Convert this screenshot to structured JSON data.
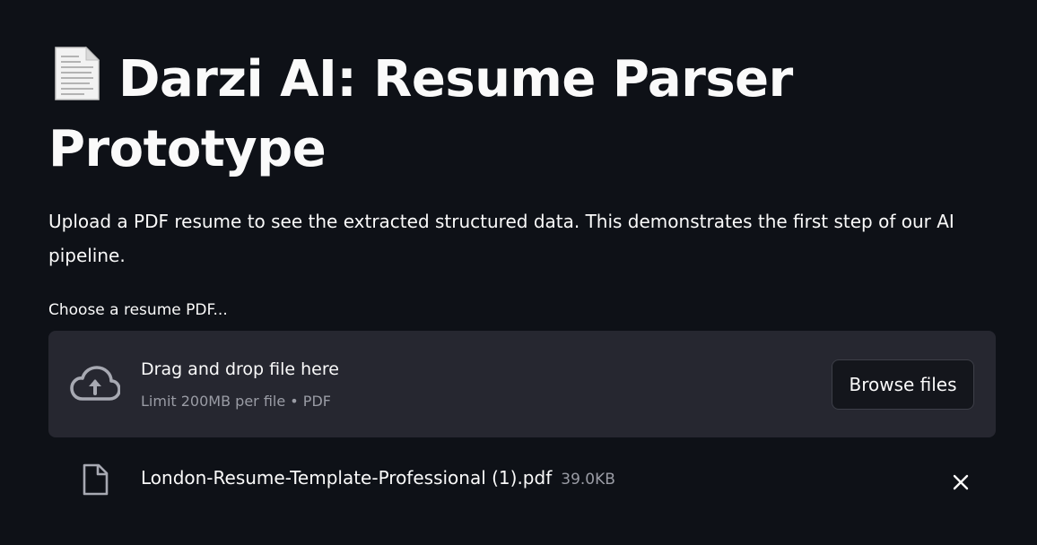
{
  "header": {
    "title_icon": "page-facing-up-icon",
    "title": "Darzi AI: Resume Parser Prototype"
  },
  "description": "Upload a PDF resume to see the extracted structured data. This demonstrates the first step of our AI pipeline.",
  "uploader": {
    "label": "Choose a resume PDF...",
    "dropzone_title": "Drag and drop file here",
    "dropzone_limit": "Limit 200MB per file • PDF",
    "browse_label": "Browse files",
    "icon": "cloud-upload-icon"
  },
  "uploaded_file": {
    "name": "London-Resume-Template-Professional (1).pdf",
    "size": "39.0KB",
    "icon": "file-icon",
    "remove_icon": "close-icon"
  },
  "colors": {
    "background": "#0e1117",
    "dropzone": "#262730",
    "text": "#fafafa",
    "muted": "#9a9ca5"
  }
}
